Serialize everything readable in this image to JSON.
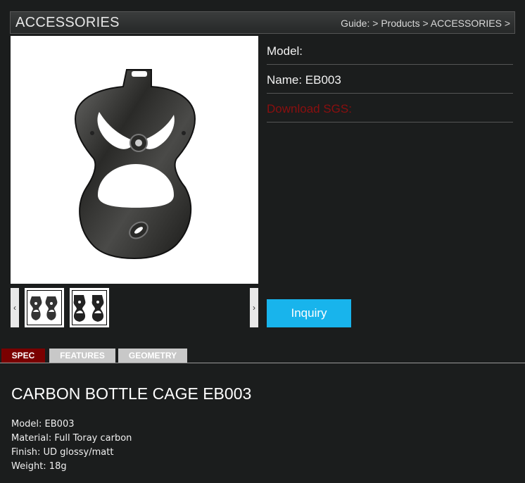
{
  "header": {
    "title": "ACCESSORIES",
    "breadcrumb": [
      "Guide:",
      "Products",
      "ACCESSORIES"
    ],
    "separator": ">"
  },
  "gallery": {
    "prev_label": "‹",
    "next_label": "›"
  },
  "product_info": {
    "model_label": "Model:",
    "name_label": "Name: EB003",
    "download_label": "Download SGS:",
    "download_color": "#8a0f0f"
  },
  "inquiry_button": {
    "label": "Inquiry",
    "color": "#18b4ec"
  },
  "tabs": [
    {
      "label": "SPEC",
      "active": true
    },
    {
      "label": "FEATURES",
      "active": false
    },
    {
      "label": "GEOMETRY",
      "active": false
    }
  ],
  "description": {
    "heading": "CARBON BOTTLE CAGE EB003",
    "specs": [
      "Model: EB003",
      "Material: Full Toray carbon",
      "Finish: UD glossy/matt",
      "Weight: 18g"
    ]
  }
}
